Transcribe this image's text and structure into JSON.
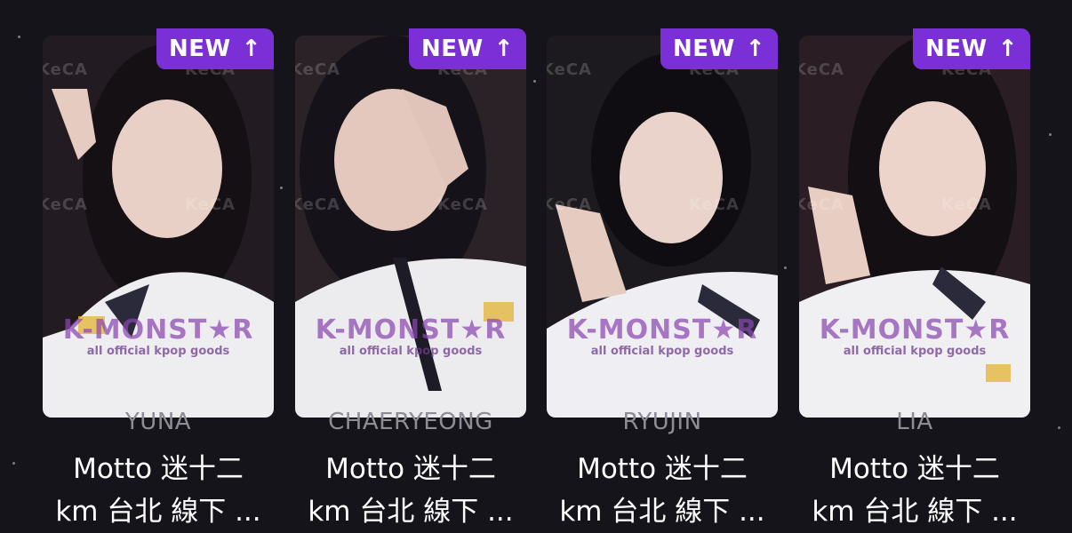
{
  "badge": {
    "label": "NEW",
    "arrow": "↑",
    "color": "#7b2fd6"
  },
  "watermark": {
    "keca": "KeCA",
    "brand_name": "K-MONST★R",
    "brand_tagline": "all official kpop goods"
  },
  "cards": [
    {
      "member": "YUNA",
      "title_line1": "Motto 迷十二",
      "title_line2": "km 台北 線下 ..."
    },
    {
      "member": "CHAERYEONG",
      "title_line1": "Motto 迷十二",
      "title_line2": "km 台北 線下 ..."
    },
    {
      "member": "RYUJIN",
      "title_line1": "Motto 迷十二",
      "title_line2": "km 台北 線下 ..."
    },
    {
      "member": "LIA",
      "title_line1": "Motto 迷十二",
      "title_line2": "km 台北 線下 ..."
    }
  ]
}
